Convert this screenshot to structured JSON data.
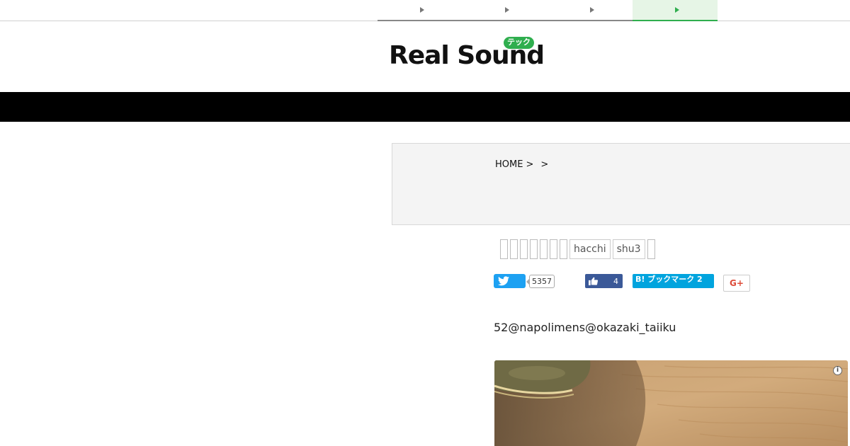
{
  "top_tabs": [
    {
      "name": "tab-1",
      "active": false
    },
    {
      "name": "tab-2",
      "active": false
    },
    {
      "name": "tab-3",
      "active": false
    },
    {
      "name": "tab-4",
      "active": true
    }
  ],
  "logo": {
    "text": "Real Sound",
    "badge": "テック",
    "accent_color": "#2fae4e"
  },
  "breadcrumb": {
    "home": "HOME",
    "separator": ">"
  },
  "tags": {
    "unrendered_glyph_count": 7,
    "items": [
      "hacchi",
      "shu3"
    ]
  },
  "share": {
    "twitter_count": "5357",
    "facebook_count": "4",
    "hatena_label": "B! ブックマーク 2",
    "googleplus_label": "G+"
  },
  "byline": "52@napolimens@okazaki_taiiku",
  "photo": {
    "icon": "info-icon",
    "info_glyph": "i"
  }
}
